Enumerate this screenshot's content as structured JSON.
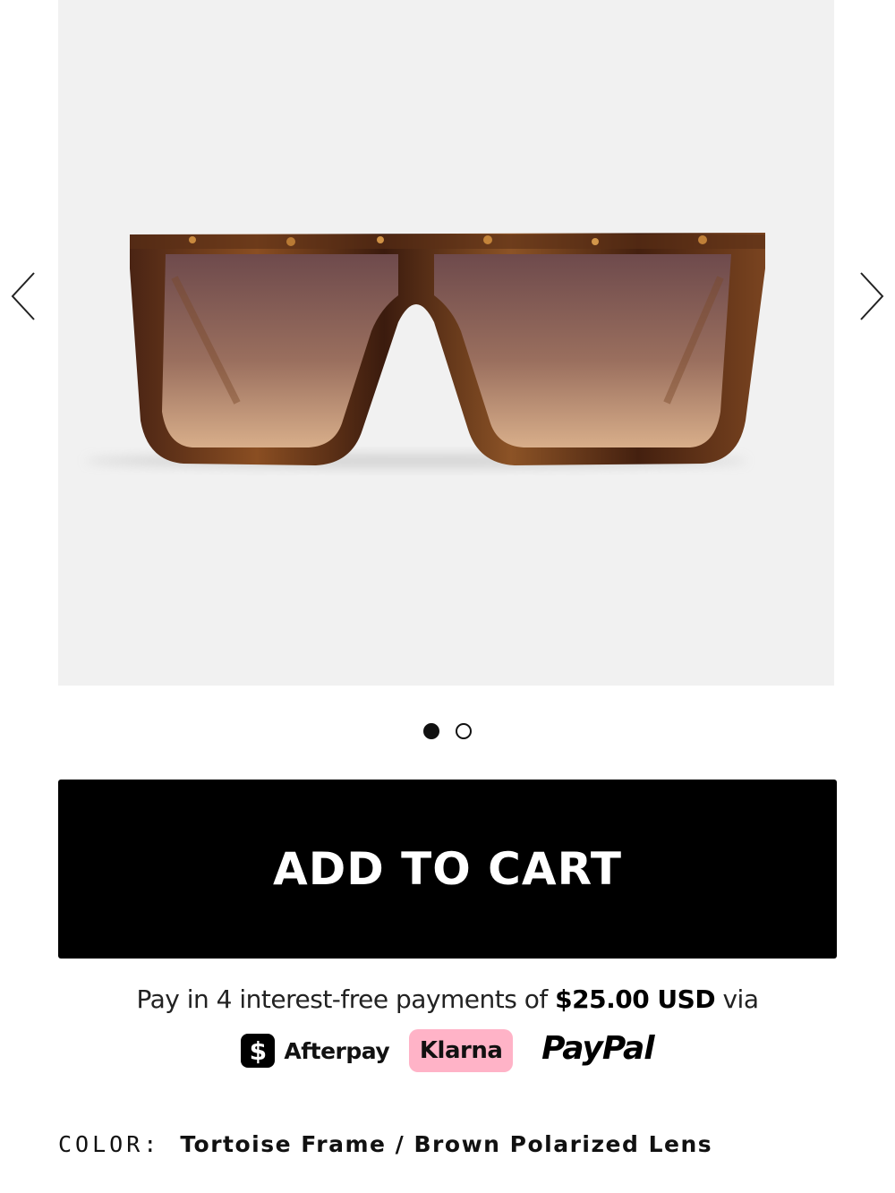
{
  "gallery": {
    "image_alt": "Tortoise frame sunglasses with brown gradient lenses",
    "icons": {
      "prev": "chevron-left-icon",
      "next": "chevron-right-icon"
    },
    "slide_count": 2,
    "active_slide": 1
  },
  "cart": {
    "label": "ADD TO CART"
  },
  "payments": {
    "prefix": "Pay in 4 interest-free payments of ",
    "amount": "$25.00 USD",
    "suffix": " via",
    "afterpay_icon": "$",
    "afterpay": "Afterpay",
    "klarna": "Klarna",
    "paypal": "PayPal",
    "klarna_color": "#ffb3c7"
  },
  "product": {
    "color_label": "COLOR:",
    "color_value": "Tortoise Frame / Brown Polarized Lens"
  },
  "colors": {
    "button": "#000000",
    "gallery_bg": "#f1f1f1",
    "lens_top": "#6e4a4c",
    "lens_bottom": "#d2a886",
    "frame": "#3a1c10"
  }
}
